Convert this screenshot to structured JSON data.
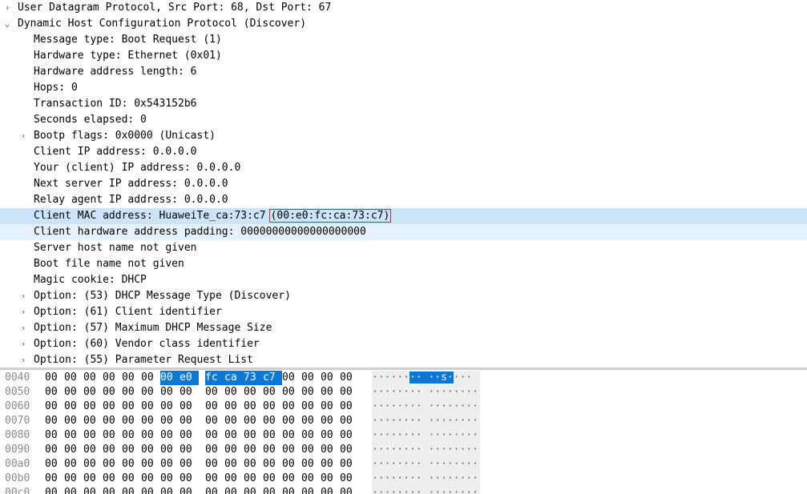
{
  "tree": {
    "rows": [
      {
        "level": 0,
        "arrow": "›",
        "text": "User Datagram Protocol, Src Port: 68, Dst Port: 67"
      },
      {
        "level": 0,
        "arrow": "⌄",
        "text": "Dynamic Host Configuration Protocol (Discover)"
      },
      {
        "level": 1,
        "arrow": "",
        "text": "Message type: Boot Request (1)"
      },
      {
        "level": 1,
        "arrow": "",
        "text": "Hardware type: Ethernet (0x01)"
      },
      {
        "level": 1,
        "arrow": "",
        "text": "Hardware address length: 6"
      },
      {
        "level": 1,
        "arrow": "",
        "text": "Hops: 0"
      },
      {
        "level": 1,
        "arrow": "",
        "text": "Transaction ID: 0x543152b6"
      },
      {
        "level": 1,
        "arrow": "",
        "text": "Seconds elapsed: 0"
      },
      {
        "level": 1,
        "arrow": "›",
        "text": "Bootp flags: 0x0000 (Unicast)"
      },
      {
        "level": 1,
        "arrow": "",
        "text": "Client IP address: 0.0.0.0"
      },
      {
        "level": 1,
        "arrow": "",
        "text": "Your (client) IP address: 0.0.0.0"
      },
      {
        "level": 1,
        "arrow": "",
        "text": "Next server IP address: 0.0.0.0"
      },
      {
        "level": 1,
        "arrow": "",
        "text": "Relay agent IP address: 0.0.0.0"
      },
      {
        "level": 1,
        "arrow": "",
        "text": "Client MAC address: HuaweiTe_ca:73:c7",
        "boxed": "(00:e0:fc:ca:73:c7)",
        "selected": true
      },
      {
        "level": 1,
        "arrow": "",
        "text": "Client hardware address padding: 00000000000000000000",
        "related": true
      },
      {
        "level": 1,
        "arrow": "",
        "text": "Server host name not given"
      },
      {
        "level": 1,
        "arrow": "",
        "text": "Boot file name not given"
      },
      {
        "level": 1,
        "arrow": "",
        "text": "Magic cookie: DHCP"
      },
      {
        "level": 1,
        "arrow": "›",
        "text": "Option: (53) DHCP Message Type (Discover)"
      },
      {
        "level": 1,
        "arrow": "›",
        "text": "Option: (61) Client identifier"
      },
      {
        "level": 1,
        "arrow": "›",
        "text": "Option: (57) Maximum DHCP Message Size"
      },
      {
        "level": 1,
        "arrow": "›",
        "text": "Option: (60) Vendor class identifier"
      },
      {
        "level": 1,
        "arrow": "›",
        "text": "Option: (55) Parameter Request List"
      }
    ]
  },
  "hex": {
    "rows": [
      {
        "offset": "0040",
        "bytes": [
          "00",
          "00",
          "00",
          "00",
          "00",
          "00",
          "00",
          "e0",
          "fc",
          "ca",
          "73",
          "c7",
          "00",
          "00",
          "00",
          "00"
        ],
        "highlight": [
          6,
          11
        ],
        "ascii": "······",
        "ascii_hl": "·· ··s·",
        "ascii_tail": "···"
      },
      {
        "offset": "0050",
        "bytes": [
          "00",
          "00",
          "00",
          "00",
          "00",
          "00",
          "00",
          "00",
          "00",
          "00",
          "00",
          "00",
          "00",
          "00",
          "00",
          "00"
        ],
        "ascii": "········ ········"
      },
      {
        "offset": "0060",
        "bytes": [
          "00",
          "00",
          "00",
          "00",
          "00",
          "00",
          "00",
          "00",
          "00",
          "00",
          "00",
          "00",
          "00",
          "00",
          "00",
          "00"
        ],
        "ascii": "········ ········"
      },
      {
        "offset": "0070",
        "bytes": [
          "00",
          "00",
          "00",
          "00",
          "00",
          "00",
          "00",
          "00",
          "00",
          "00",
          "00",
          "00",
          "00",
          "00",
          "00",
          "00"
        ],
        "ascii": "········ ········"
      },
      {
        "offset": "0080",
        "bytes": [
          "00",
          "00",
          "00",
          "00",
          "00",
          "00",
          "00",
          "00",
          "00",
          "00",
          "00",
          "00",
          "00",
          "00",
          "00",
          "00"
        ],
        "ascii": "········ ········"
      },
      {
        "offset": "0090",
        "bytes": [
          "00",
          "00",
          "00",
          "00",
          "00",
          "00",
          "00",
          "00",
          "00",
          "00",
          "00",
          "00",
          "00",
          "00",
          "00",
          "00"
        ],
        "ascii": "········ ········"
      },
      {
        "offset": "00a0",
        "bytes": [
          "00",
          "00",
          "00",
          "00",
          "00",
          "00",
          "00",
          "00",
          "00",
          "00",
          "00",
          "00",
          "00",
          "00",
          "00",
          "00"
        ],
        "ascii": "········ ········"
      },
      {
        "offset": "00b0",
        "bytes": [
          "00",
          "00",
          "00",
          "00",
          "00",
          "00",
          "00",
          "00",
          "00",
          "00",
          "00",
          "00",
          "00",
          "00",
          "00",
          "00"
        ],
        "ascii": "········ ········"
      },
      {
        "offset": "00c0",
        "bytes": [
          "00",
          "00",
          "00",
          "00",
          "00",
          "00",
          "00",
          "00",
          "00",
          "00",
          "00",
          "00",
          "00",
          "00",
          "00",
          "00"
        ],
        "ascii": "········ ········"
      }
    ]
  },
  "colors": {
    "selection": "#cce4f7",
    "related": "#e5f1fb",
    "byte_highlight": "#0b78d6",
    "annotation_box": "#d62828"
  }
}
